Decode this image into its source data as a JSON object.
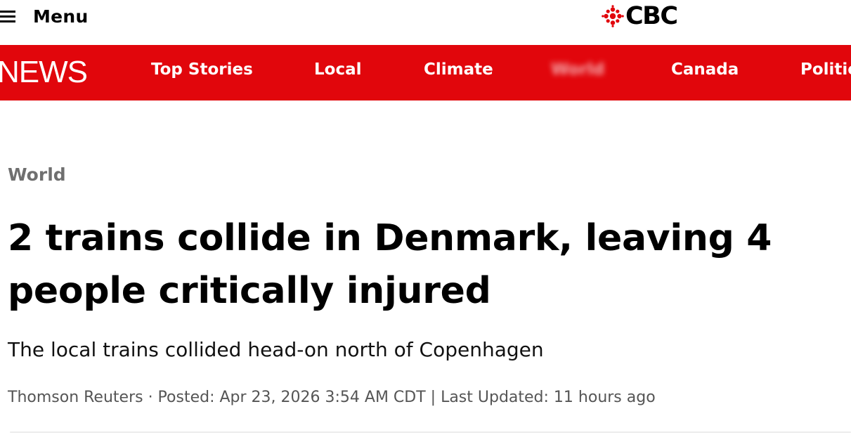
{
  "header": {
    "menu_label": "Menu",
    "logo_text": "CBC"
  },
  "nav": {
    "brand": "NEWS",
    "items": [
      {
        "label": "Top Stories"
      },
      {
        "label": "Local"
      },
      {
        "label": "Climate"
      },
      {
        "label": "World"
      },
      {
        "label": "Canada"
      },
      {
        "label": "Politics"
      }
    ]
  },
  "article": {
    "section": "World",
    "headline_line1": "2 trains collide in Denmark, leaving 4",
    "headline_line2": "people critically injured",
    "deck": "The local trains collided head-on north of Copenhagen",
    "byline": "Thomson Reuters · Posted: Apr 23, 2026 3:54 AM CDT | Last Updated: 11 hours ago"
  },
  "colors": {
    "brand_red": "#e1060c",
    "section_gray": "#6f6f6f"
  },
  "icons": {
    "menu": "hamburger-icon",
    "logo": "cbc-gem-logo"
  }
}
